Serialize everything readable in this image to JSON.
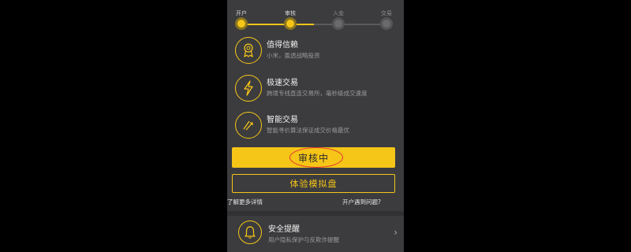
{
  "steps": [
    {
      "label": "开户",
      "state": "done"
    },
    {
      "label": "审核",
      "state": "done"
    },
    {
      "label": "入金",
      "state": "todo"
    },
    {
      "label": "交易",
      "state": "todo"
    }
  ],
  "features": [
    {
      "icon": "award-ribbon-icon",
      "title": "值得信赖",
      "desc": "小米，盈透战略投资"
    },
    {
      "icon": "lightning-bolt-icon",
      "title": "极速交易",
      "desc": "跨境专线直连交易所，毫秒级成交速度"
    },
    {
      "icon": "smart-trend-icon",
      "title": "智能交易",
      "desc": "智能寻价算法保证成交价格最优"
    }
  ],
  "primary_button": "审核中",
  "secondary_button": "体验模拟盘",
  "links": {
    "more_details": "了解更多详情",
    "problems": "开户遇到问题?"
  },
  "alert": {
    "icon": "bell-icon",
    "title": "安全提醒",
    "desc": "用户隐私保护与反欺诈提醒"
  },
  "colors": {
    "accent": "#f5c518",
    "background": "#3c3c3e",
    "annotation": "#e3342f"
  }
}
